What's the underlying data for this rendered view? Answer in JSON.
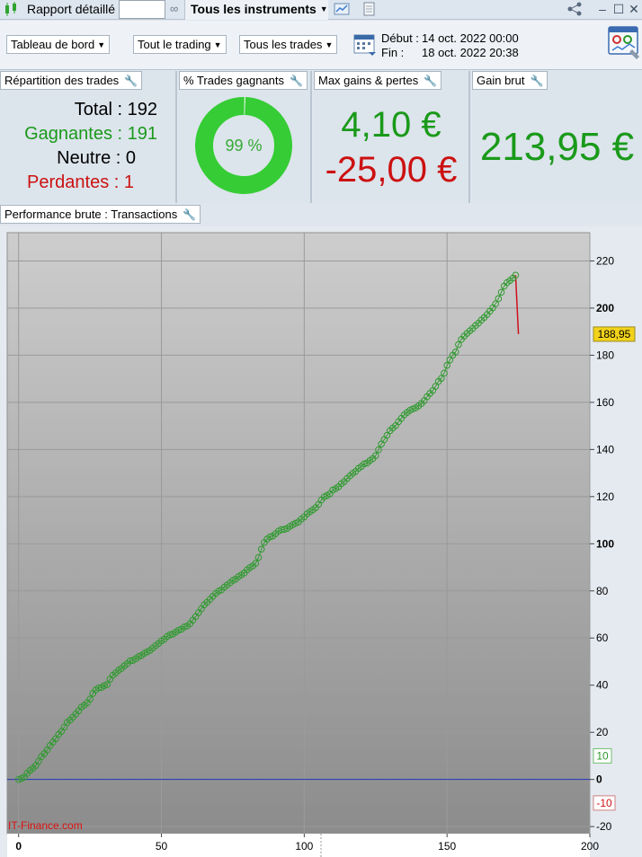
{
  "titlebar": {
    "report_label": "Rapport détaillé",
    "report_input_value": "",
    "instruments_label": "Tous les instruments"
  },
  "toolbar": {
    "dashboard_label": "Tableau de bord",
    "trading_label": "Tout le trading",
    "trades_label": "Tous les trades",
    "start_label": "Début :",
    "start_value": "14 oct. 2022 00:00",
    "end_label": "Fin :",
    "end_value": "18 oct. 2022 20:38"
  },
  "widgets": {
    "repartition": {
      "title": "Répartition des trades",
      "total": "Total : 192",
      "winners": "Gagnantes : 191",
      "neutral": "Neutre : 0",
      "losers": "Perdantes : 1"
    },
    "win_rate": {
      "title": "% Trades gagnants",
      "value": "99 %",
      "fraction": 0.995
    },
    "max_gains_losses": {
      "title": "Max gains & pertes",
      "max_gain": "4,10 €",
      "max_loss": "-25,00 €"
    },
    "gross_gain": {
      "title": "Gain brut",
      "value": "213,95 €"
    }
  },
  "performance": {
    "title": "Performance brute : Transactions"
  },
  "colors": {
    "green": "#1a9a1a",
    "red": "#cc1111",
    "donut": "#35cc35",
    "line": "#3a9a3a",
    "loss_line": "#d0101e",
    "zero_line": "#2233bb",
    "last_value_bg": "#f2d21a"
  },
  "chart_data": {
    "type": "line",
    "watermark": "IT-Finance.com",
    "x_ticks": [
      "0",
      "50",
      "100",
      "150",
      "200"
    ],
    "y_ticks": [
      "220",
      "200",
      "180",
      "160",
      "140",
      "120",
      "100",
      "80",
      "60",
      "40",
      "20",
      "0",
      "-20"
    ],
    "xlim": [
      -4,
      200
    ],
    "ylim": [
      -23,
      232
    ],
    "last_value_label": "188,95",
    "marker_pos_label": "10",
    "marker_neg_label": "-10",
    "series": [
      {
        "values": [
          0.0,
          0.4,
          1.0,
          2.6,
          3.8,
          4.8,
          5.9,
          7.7,
          9.7,
          11.0,
          12.5,
          14.4,
          15.8,
          17.3,
          19.1,
          20.4,
          22.2,
          24.2,
          25.2,
          26.4,
          27.7,
          29.1,
          30.7,
          31.5,
          32.5,
          34.1,
          36.5,
          38.0,
          38.8,
          39.0,
          39.8,
          40.3,
          42.6,
          44.2,
          45.2,
          46.3,
          47.1,
          48.2,
          49.1,
          50.3,
          50.5,
          51.2,
          52.1,
          52.6,
          53.5,
          54.1,
          54.8,
          55.8,
          56.8,
          57.7,
          58.8,
          59.5,
          60.7,
          61.4,
          61.7,
          62.5,
          63.3,
          63.7,
          64.7,
          65.1,
          66.1,
          67.6,
          69.1,
          70.8,
          72.4,
          74.1,
          75.2,
          76.4,
          77.7,
          78.9,
          79.9,
          80.4,
          81.6,
          82.5,
          83.4,
          84.4,
          85.0,
          86.1,
          86.8,
          87.6,
          88.9,
          89.9,
          90.6,
          91.7,
          94.2,
          97.7,
          100.5,
          102.0,
          102.9,
          103.3,
          104.3,
          105.4,
          106.0,
          106.1,
          106.5,
          107.4,
          108.1,
          108.7,
          109.3,
          110.5,
          111.4,
          112.7,
          113.6,
          114.4,
          115.3,
          116.7,
          118.6,
          119.9,
          120.5,
          121.2,
          122.8,
          123.4,
          124.2,
          125.5,
          126.4,
          127.7,
          128.8,
          129.9,
          130.7,
          132.0,
          132.8,
          133.9,
          134.3,
          135.3,
          136.1,
          137.4,
          139.9,
          142.3,
          144.2,
          146.0,
          148.0,
          149.1,
          150.1,
          151.8,
          153.2,
          154.7,
          155.7,
          156.6,
          157.2,
          157.7,
          158.5,
          159.5,
          160.7,
          162.4,
          163.8,
          165.0,
          166.8,
          168.9,
          170.2,
          172.4,
          175.7,
          178.0,
          180.0,
          181.4,
          184.5,
          186.7,
          188.1,
          189.3,
          190.4,
          191.4,
          192.6,
          193.6,
          194.9,
          196.0,
          197.3,
          198.7,
          200.1,
          201.8,
          204.0,
          206.7,
          209.3,
          210.8,
          211.7,
          212.7,
          213.95,
          188.95
        ]
      }
    ]
  }
}
